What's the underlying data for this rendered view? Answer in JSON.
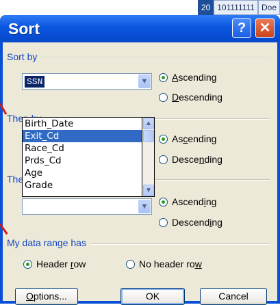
{
  "sheet": {
    "row_number": "20",
    "cells": [
      "101111111",
      "Doe"
    ]
  },
  "window": {
    "title": "Sort",
    "help_glyph": "?",
    "close_glyph": "✕"
  },
  "sort_by": {
    "legend": "Sort by",
    "combo_value": "SSN",
    "ascending_pre": "",
    "ascending_key": "A",
    "ascending_post": "scending",
    "descending_pre": "",
    "descending_key": "D",
    "descending_post": "escending",
    "selected": "ascending"
  },
  "dropdown": {
    "items": [
      "Birth_Date",
      "Exit_Cd",
      "Race_Cd",
      "Prds_Cd",
      "Age",
      "Grade"
    ],
    "highlighted": "Exit_Cd"
  },
  "then_by_1": {
    "legend": "Then by",
    "ascending_pre": "As",
    "ascending_key": "c",
    "ascending_post": "ending",
    "descending_pre": "Desce",
    "descending_key": "n",
    "descending_post": "ding",
    "selected": "ascending"
  },
  "then_by_2": {
    "legend": "Then by",
    "combo_value": "",
    "ascending_pre": "Ascend",
    "ascending_key": "i",
    "ascending_post": "ng",
    "descending_pre": "Descend",
    "descending_key": "i",
    "descending_post": "ng",
    "selected": "ascending"
  },
  "data_range": {
    "legend": "My data range has",
    "header_pre": "Header ",
    "header_key": "r",
    "header_post": "ow",
    "noheader_pre": "No header ro",
    "noheader_key": "w",
    "noheader_post": "",
    "selected": "header_row"
  },
  "buttons": {
    "options_key": "O",
    "options_post": "ptions...",
    "ok": "OK",
    "cancel": "Cancel"
  },
  "colors": {
    "titlebar": "#0b56e0",
    "client": "#ece9d8",
    "legend": "#1546c7",
    "annotation": "#d21b1b",
    "highlight": "#316ac5"
  }
}
